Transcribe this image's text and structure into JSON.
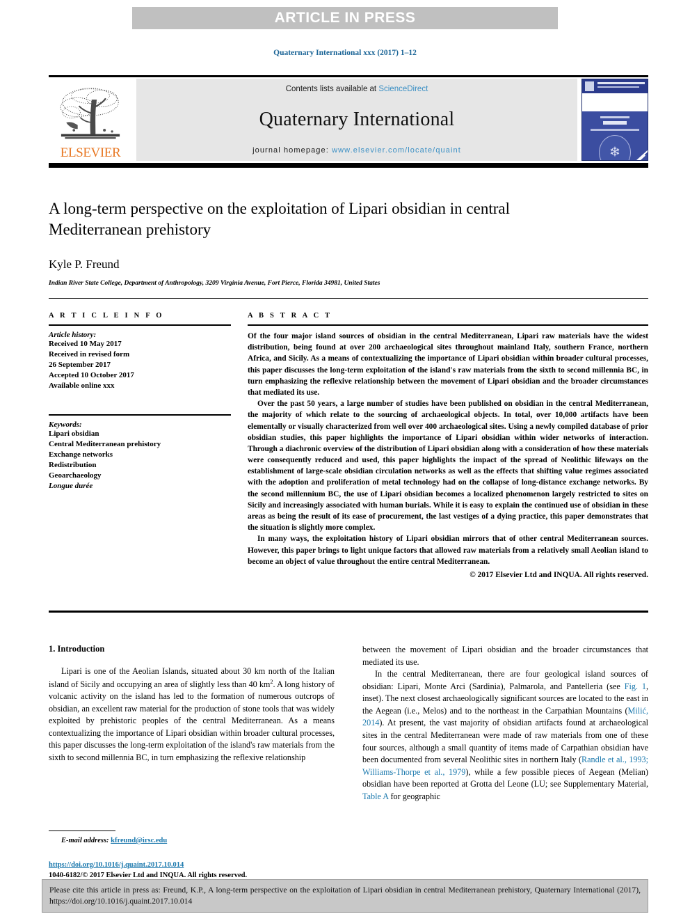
{
  "banner": {
    "text": "ARTICLE IN PRESS"
  },
  "running_head": "Quaternary International xxx (2017) 1–12",
  "masthead": {
    "contents_prefix": "Contents lists available at ",
    "sciencedirect": "ScienceDirect",
    "journal_name": "Quaternary International",
    "homepage_prefix": "journal homepage: ",
    "homepage_url": "www.elsevier.com/locate/quaint",
    "publisher": "ELSEVIER",
    "accent_orange": "#e87722",
    "link_blue": "#3a8fc4",
    "cover_blue": "#3b4da0"
  },
  "article": {
    "title": "A long-term perspective on the exploitation of Lipari obsidian in central Mediterranean prehistory",
    "author": "Kyle P. Freund",
    "affiliation": "Indian River State College, Department of Anthropology, 3209 Virginia Avenue, Fort Pierce, Florida 34981, United States"
  },
  "info": {
    "heading": "A R T I C L E   I N F O",
    "history_label": "Article history:",
    "history": [
      "Received 10 May 2017",
      "Received in revised form",
      "26 September 2017",
      "Accepted 10 October 2017",
      "Available online xxx"
    ],
    "keywords_label": "Keywords:",
    "keywords": [
      "Lipari obsidian",
      "Central Mediterranean prehistory",
      "Exchange networks",
      "Redistribution",
      "Geoarchaeology"
    ],
    "keyword_italic": "Longue durée"
  },
  "abstract": {
    "heading": "A B S T R A C T",
    "paragraphs": [
      "Of the four major island sources of obsidian in the central Mediterranean, Lipari raw materials have the widest distribution, being found at over 200 archaeological sites throughout mainland Italy, southern France, northern Africa, and Sicily. As a means of contextualizing the importance of Lipari obsidian within broader cultural processes, this paper discusses the long-term exploitation of the island's raw materials from the sixth to second millennia BC, in turn emphasizing the reflexive relationship between the movement of Lipari obsidian and the broader circumstances that mediated its use.",
      "Over the past 50 years, a large number of studies have been published on obsidian in the central Mediterranean, the majority of which relate to the sourcing of archaeological objects. In total, over 10,000 artifacts have been elementally or visually characterized from well over 400 archaeological sites. Using a newly compiled database of prior obsidian studies, this paper highlights the importance of Lipari obsidian within wider networks of interaction. Through a diachronic overview of the distribution of Lipari obsidian along with a consideration of how these materials were consequently reduced and used, this paper highlights the impact of the spread of Neolithic lifeways on the establishment of large-scale obsidian circulation networks as well as the effects that shifting value regimes associated with the adoption and proliferation of metal technology had on the collapse of long-distance exchange networks. By the second millennium BC, the use of Lipari obsidian becomes a localized phenomenon largely restricted to sites on Sicily and increasingly associated with human burials. While it is easy to explain the continued use of obsidian in these areas as being the result of its ease of procurement, the last vestiges of a dying practice, this paper demonstrates that the situation is slightly more complex.",
      "In many ways, the exploitation history of Lipari obsidian mirrors that of other central Mediterranean sources. However, this paper brings to light unique factors that allowed raw materials from a relatively small Aeolian island to become an object of value throughout the entire central Mediterranean."
    ],
    "copyright": "© 2017 Elsevier Ltd and INQUA. All rights reserved."
  },
  "body": {
    "section_number_title": "1.  Introduction",
    "left_paragraph_part1": "Lipari is one of the Aeolian Islands, situated about 30 km north of the Italian island of Sicily and occupying an area of slightly less than 40 km",
    "left_paragraph_sup": "2",
    "left_paragraph_part2": ". A long history of volcanic activity on the island has led to the formation of numerous outcrops of obsidian, an excellent raw material for the production of stone tools that was widely exploited by prehistoric peoples of the central Mediterranean. As a means contextualizing the importance of Lipari obsidian within broader cultural processes, this paper discusses the long-term exploitation of the island's raw materials from the sixth to second millennia BC, in turn emphasizing the reflexive relationship",
    "right_continuation": "between the movement of Lipari obsidian and the broader circumstances that mediated its use.",
    "right_p2_a": "In the central Mediterranean, there are four geological island sources of obsidian: Lipari, Monte Arci (Sardinia), Palmarola, and Pantelleria (see ",
    "right_link_fig1": "Fig. 1",
    "right_p2_b": ", inset). The next closest archaeologically significant sources are located to the east in the Aegean (i.e., Melos) and to the northeast in the Carpathian Mountains (",
    "right_link_milic": "Milić, 2014",
    "right_p2_c": "). At present, the vast majority of obsidian artifacts found at archaeological sites in the central Mediterranean were made of raw materials from one of these four sources, although a small quantity of items made of Carpathian obsidian have been documented from several Neolithic sites in northern Italy (",
    "right_link_randle": "Randle et al., 1993; Williams-Thorpe et al., 1979",
    "right_p2_d": "), while a few possible pieces of Aegean (Melian) obsidian have been reported at Grotta del Leone (LU; see Supplementary Material, ",
    "right_link_tablea": "Table A",
    "right_p2_e": " for geographic"
  },
  "footnote": {
    "email_label": "E-mail address:",
    "email": "kfreund@irsc.edu",
    "doi": "https://doi.org/10.1016/j.quaint.2017.10.014",
    "issn_copyright": "1040-6182/© 2017 Elsevier Ltd and INQUA. All rights reserved."
  },
  "cite_box": {
    "text": "Please cite this article in press as: Freund, K.P., A long-term perspective on the exploitation of Lipari obsidian in central Mediterranean prehistory, Quaternary International (2017), https://doi.org/10.1016/j.quaint.2017.10.014"
  }
}
